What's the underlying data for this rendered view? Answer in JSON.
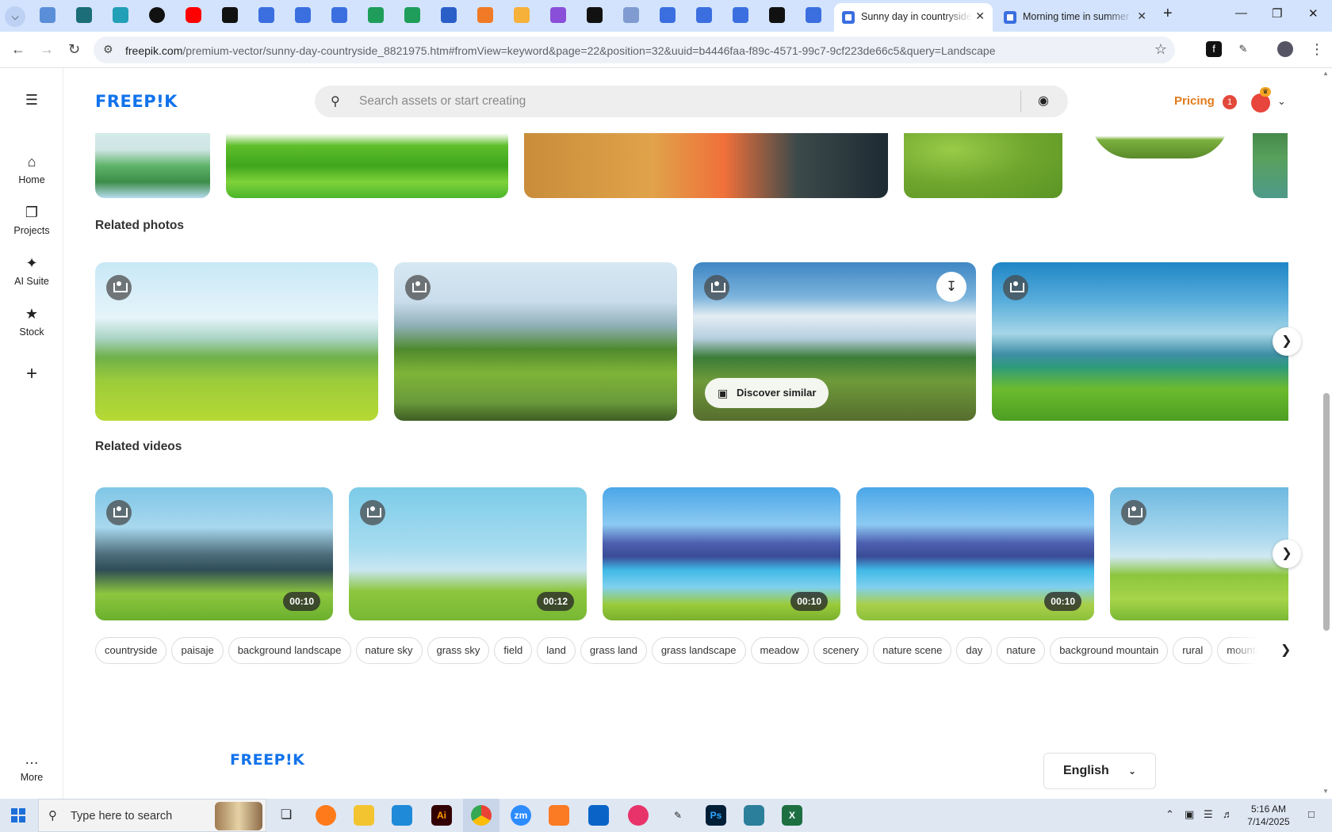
{
  "browser": {
    "tabs": [
      {
        "title": "Sunny day in countryside",
        "active": true
      },
      {
        "title": "Morning time in summer",
        "active": false
      }
    ],
    "new_tab": "+",
    "url": {
      "host": "freepik.com",
      "path": "/premium-vector/sunny-day-countryside_8821975.htm#fromView=keyword&page=22&position=32&uuid=b4446faa-f89c-4571-99c7-9cf223de66c5&query=Landscape"
    }
  },
  "site": {
    "logo": "FREEP!K",
    "search_placeholder": "Search assets or start creating",
    "pricing": "Pricing",
    "notification_count": "1"
  },
  "sidebar": {
    "items": [
      {
        "label": "Home",
        "icon": "home-icon"
      },
      {
        "label": "Projects",
        "icon": "projects-icon"
      },
      {
        "label": "AI Suite",
        "icon": "sparkle-icon"
      },
      {
        "label": "Stock",
        "icon": "stock-icon"
      }
    ],
    "more": "More"
  },
  "related_photos": {
    "title": "Related photos",
    "discover_similar": "Discover similar"
  },
  "related_videos": {
    "title": "Related videos",
    "durations": [
      "00:10",
      "00:12",
      "00:10",
      "00:10"
    ]
  },
  "tags": [
    "countryside",
    "paisaje",
    "background landscape",
    "nature sky",
    "grass sky",
    "field",
    "land",
    "grass land",
    "grass landscape",
    "meadow",
    "scenery",
    "nature scene",
    "day",
    "nature",
    "background mountain",
    "rural",
    "mountain"
  ],
  "footer": {
    "logo": "FREEP!K",
    "language": "English"
  },
  "taskbar": {
    "search_text": "Type here to search",
    "time": "5:16 AM",
    "date": "7/14/2025"
  },
  "colors": {
    "brand": "#1273eb",
    "pricing": "#e07a1a"
  }
}
